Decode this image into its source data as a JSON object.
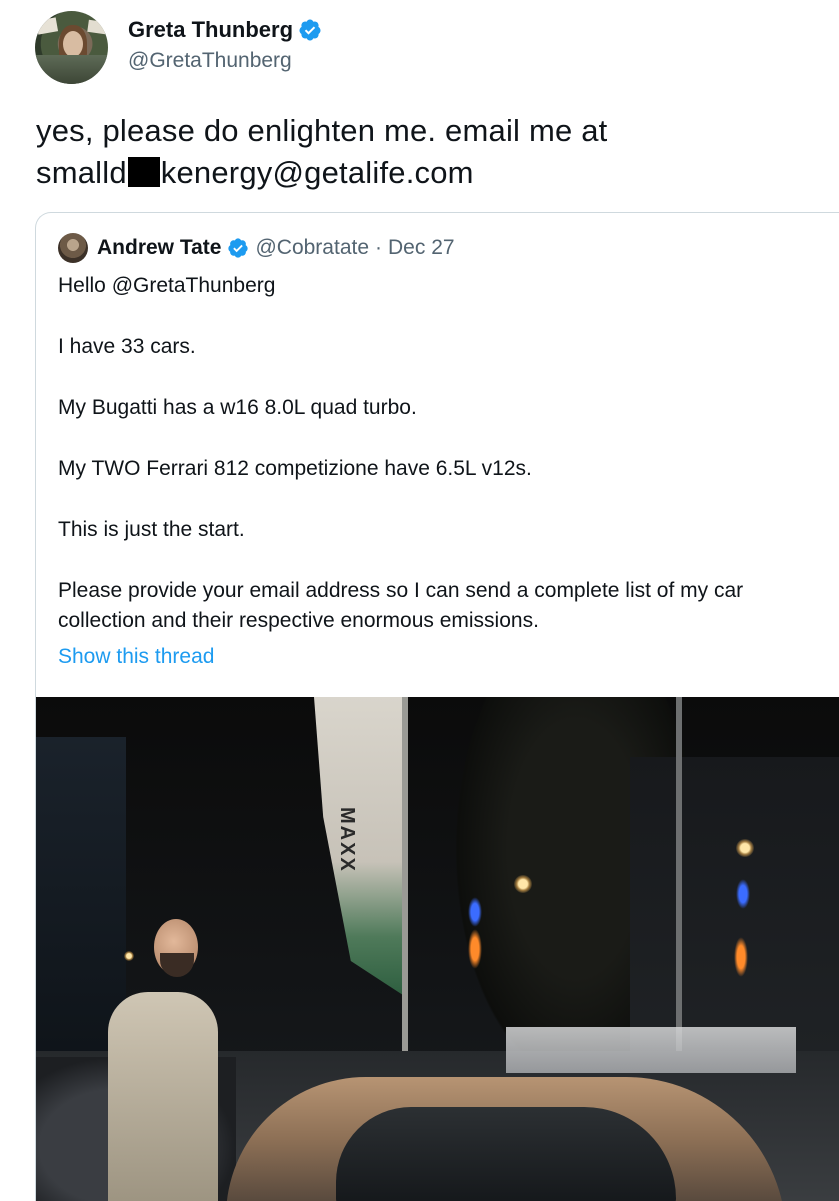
{
  "tweet": {
    "author": {
      "name": "Greta Thunberg",
      "handle": "@GretaThunberg",
      "verified": true
    },
    "text_line1": "yes, please do enlighten me. email me at",
    "text_line2_prefix": "smalld",
    "text_line2_suffix": "kenergy@getalife.com"
  },
  "quote": {
    "author": {
      "name": "Andrew Tate",
      "handle": "@Cobratate",
      "separator": "·",
      "date": "Dec 27",
      "verified": true
    },
    "lines": [
      "Hello @GretaThunberg",
      "I have 33 cars.",
      "My Bugatti has a w16 8.0L quad turbo.",
      "My TWO Ferrari 812 competizione have 6.5L v12s.",
      "This is just the start.",
      "Please provide your email address so I can send a complete list of my car collection and their respective enormous emissions."
    ],
    "show_thread": "Show this thread",
    "photo": {
      "flag_text": "MAXX"
    }
  },
  "colors": {
    "text": "#0f1419",
    "secondary": "#536471",
    "link": "#1d9bf0",
    "verified": "#1d9bf0",
    "border": "#cfd9de"
  }
}
